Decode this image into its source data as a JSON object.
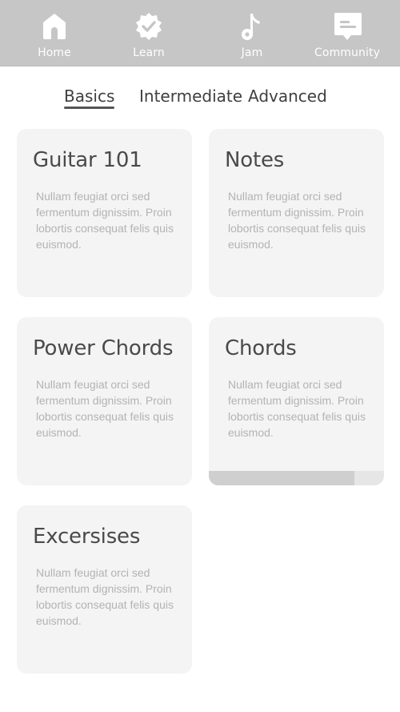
{
  "nav": {
    "items": [
      {
        "label": "Home",
        "icon": "home-icon"
      },
      {
        "label": "Learn",
        "icon": "badge-check-icon"
      },
      {
        "label": "Jam",
        "icon": "music-note-icon"
      },
      {
        "label": "Community",
        "icon": "chat-icon"
      }
    ]
  },
  "tabs": {
    "items": [
      {
        "label": "Basics",
        "active": true
      },
      {
        "label": "Intermediate",
        "active": false
      },
      {
        "label": "Advanced",
        "active": false
      }
    ]
  },
  "cards": [
    {
      "title": "Guitar 101",
      "description": "Nullam feugiat orci sed fermentum dignissim. Proin lobortis consequat felis quis euismod."
    },
    {
      "title": "Notes",
      "description": "Nullam feugiat orci sed fermentum dignissim. Proin lobortis consequat felis quis euismod."
    },
    {
      "title": "Power Chords",
      "description": "Nullam feugiat orci sed fermentum dignissim. Proin lobortis consequat felis quis euismod."
    },
    {
      "title": "Chords",
      "description": "Nullam feugiat orci sed fermentum dignissim. Proin lobortis consequat felis quis euismod.",
      "progress": 0.83
    },
    {
      "title": "Excersises",
      "description": "Nullam feugiat orci sed fermentum dignissim. Proin lobortis consequat felis quis euismod."
    }
  ],
  "colors": {
    "nav_bg": "#c6c6c6",
    "card_bg": "#f4f4f4",
    "progress_fill": "#cfcfcf",
    "progress_track": "#e6e6e6",
    "text_dark": "#4a4a4a",
    "text_muted": "#b3b3b3"
  }
}
